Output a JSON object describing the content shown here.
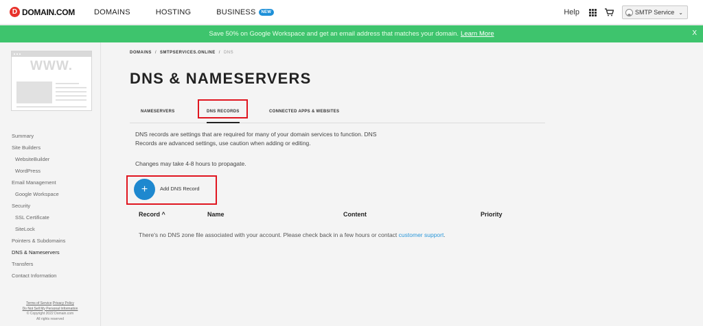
{
  "brand": {
    "logo_mark": "D",
    "name": "DOMAIN.COM"
  },
  "nav": {
    "links": [
      {
        "label": "DOMAINS"
      },
      {
        "label": "HOSTING"
      },
      {
        "label": "BUSINESS",
        "badge": "NEW"
      }
    ],
    "help": "Help",
    "account": "SMTP Service"
  },
  "promo": {
    "text": "Save 50% on Google Workspace and get an email address that matches your domain.",
    "link": "Learn More",
    "close": "X"
  },
  "sidebar": {
    "thumbnail_text": "WWW.",
    "items": [
      {
        "label": "Summary"
      },
      {
        "label": "Site Builders"
      },
      {
        "label": "WebsiteBuilder"
      },
      {
        "label": "WordPress"
      },
      {
        "label": "Email Management"
      },
      {
        "label": "Google Workspace"
      },
      {
        "label": "Security"
      },
      {
        "label": "SSL Certificate"
      },
      {
        "label": "SiteLock"
      },
      {
        "label": "Pointers & Subdomains"
      },
      {
        "label": "DNS & Nameservers"
      },
      {
        "label": "Transfers"
      },
      {
        "label": "Contact Information"
      }
    ],
    "footer": {
      "terms": "Terms of Service",
      "privacy": "Privacy Policy",
      "do_not_sell": "Do Not Sell My Personal Information",
      "copyright": "© Copyright 2022 Domain.com",
      "rights": "All rights reserved"
    }
  },
  "breadcrumb": [
    "DOMAINS",
    "SMTPSERVICES.ONLINE",
    "DNS"
  ],
  "breadcrumb_sep": "/",
  "page_title": "DNS & NAMESERVERS",
  "tabs": [
    {
      "label": "NAMESERVERS"
    },
    {
      "label": "DNS RECORDS",
      "active": true
    },
    {
      "label": "CONNECTED APPS & WEBSITES"
    }
  ],
  "description_line1": "DNS records are settings that are required for many of your domain services to function. DNS",
  "description_line2": "Records are advanced settings, use caution when adding or editing.",
  "propagate_note": "Changes may take 4-8 hours to propagate.",
  "add_record": {
    "icon": "+",
    "label": "Add DNS Record"
  },
  "table": {
    "columns": [
      {
        "label": "Record ^"
      },
      {
        "label": "Name"
      },
      {
        "label": "Content"
      },
      {
        "label": "Priority"
      }
    ],
    "empty_message": "There's no DNS zone file associated with your account. Please check back in a few hours or contact",
    "empty_link": "customer support",
    "empty_end": "."
  },
  "colors": {
    "promo_green": "#3ec46d",
    "accent_blue": "#1e88cf",
    "highlight_red": "#e0141e",
    "logo_red": "#e8322b"
  }
}
